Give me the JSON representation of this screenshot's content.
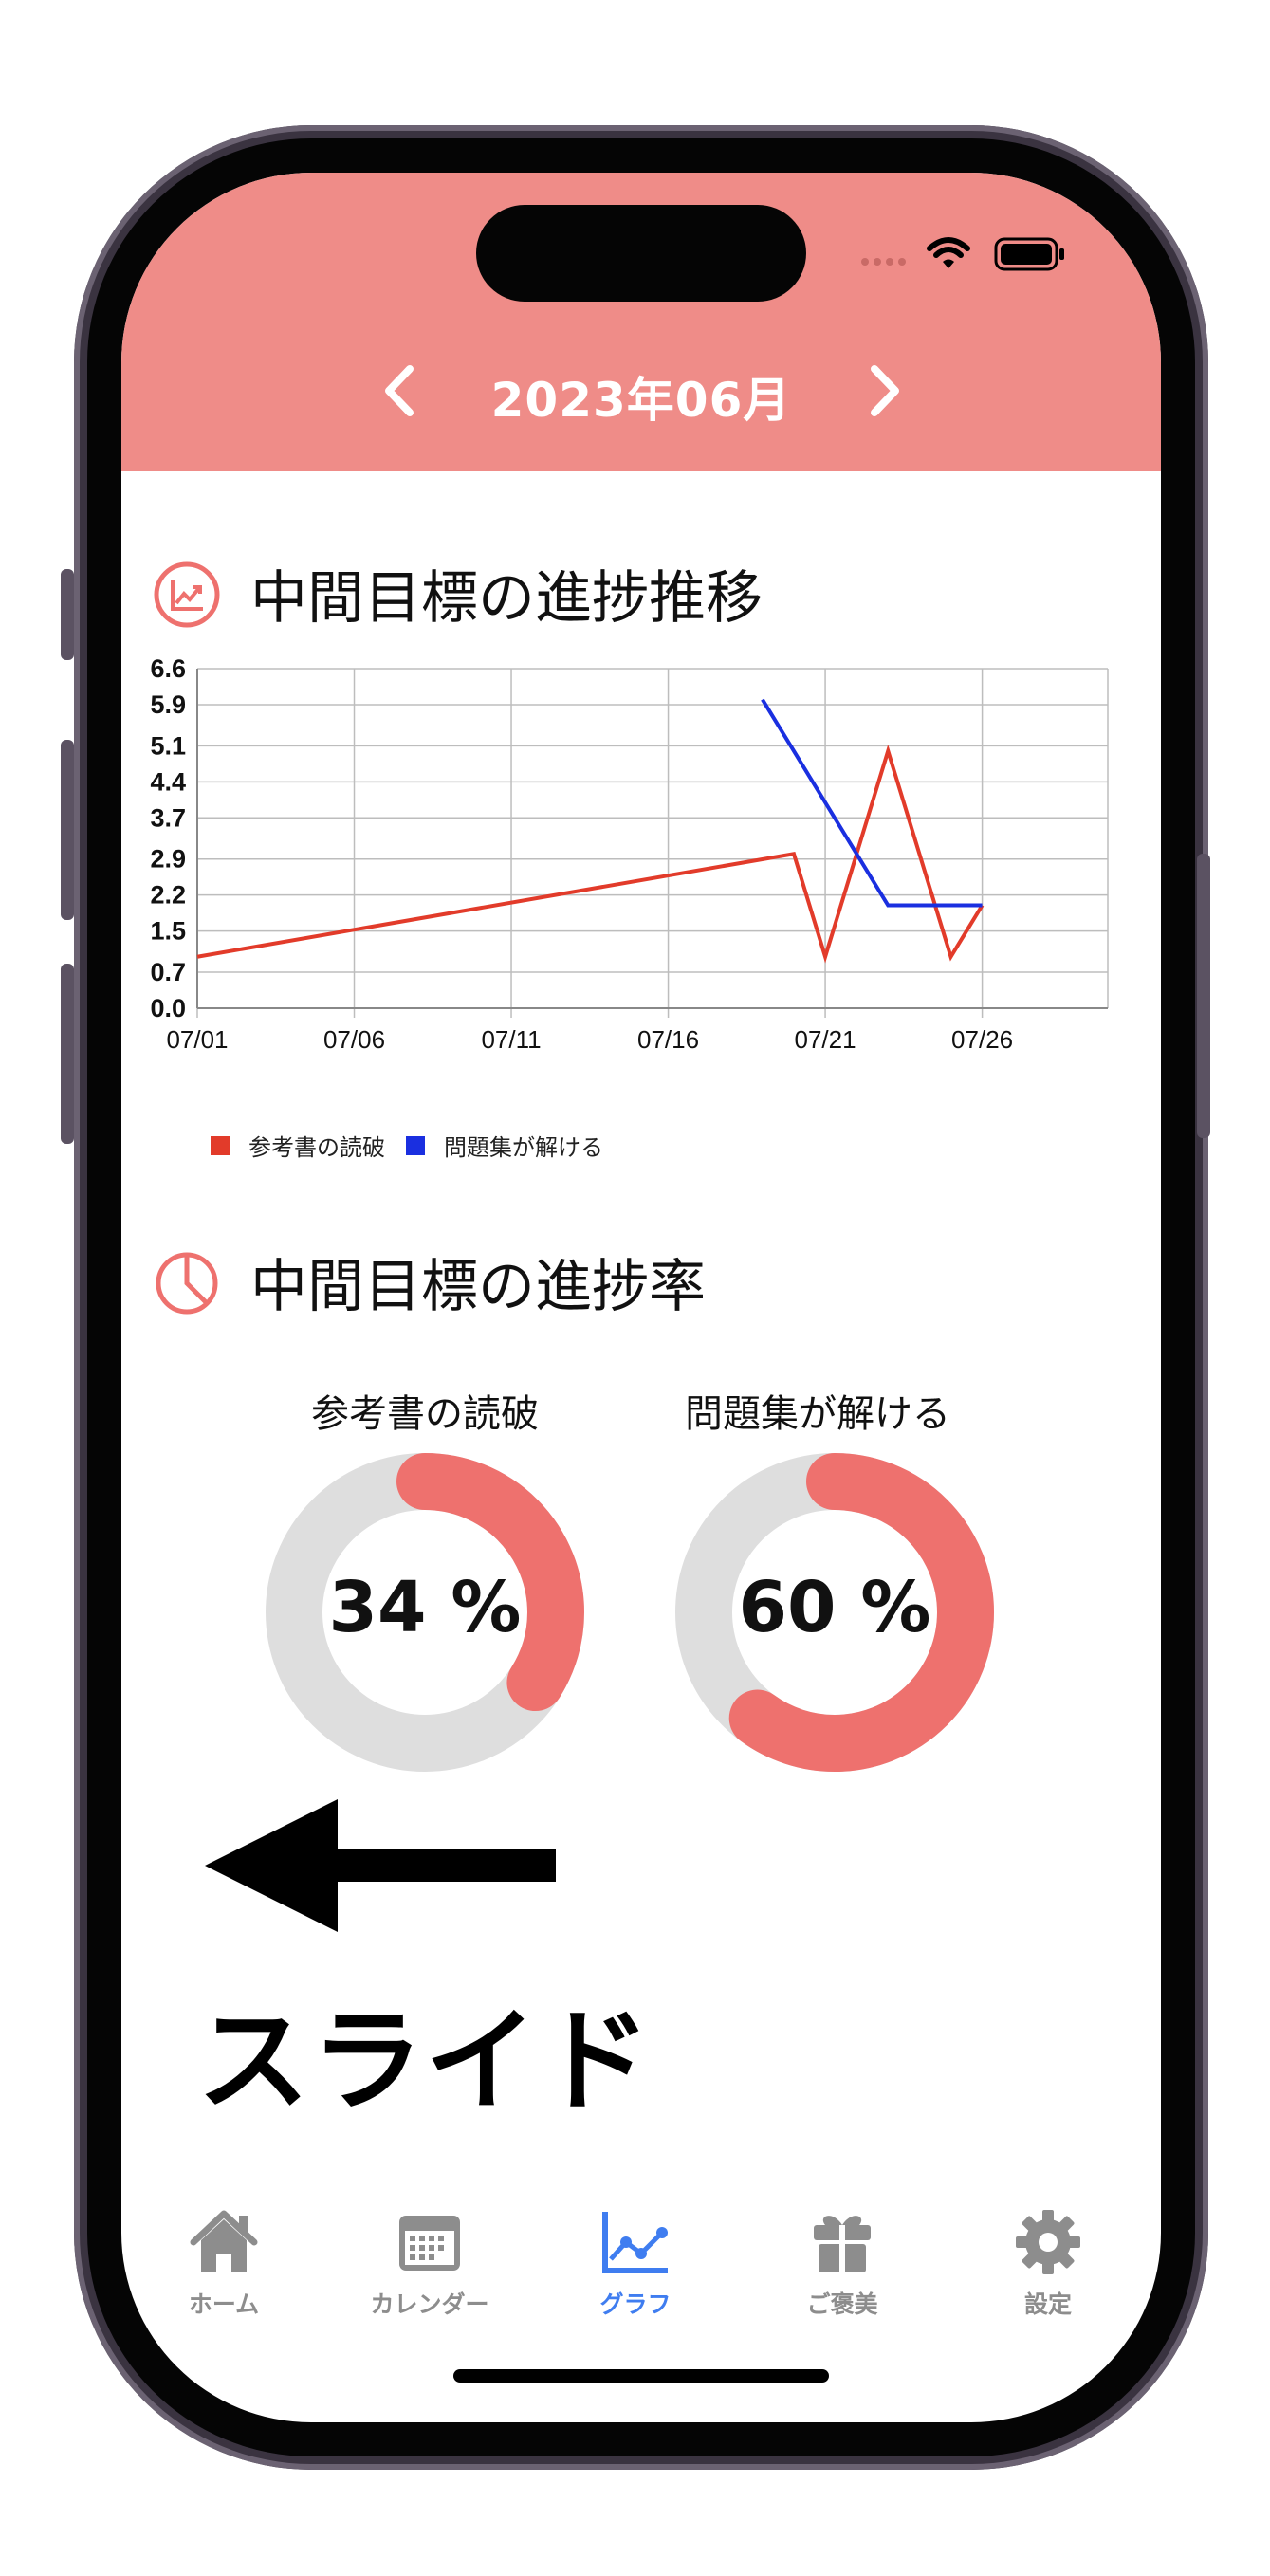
{
  "header": {
    "month_title": "2023年06月",
    "prev_icon": "chevron-left-icon",
    "next_icon": "chevron-right-icon",
    "background": "#ef8c88"
  },
  "status_bar": {
    "icons": [
      "signal-dots-icon",
      "wifi-icon",
      "battery-icon"
    ]
  },
  "progress_trend": {
    "title": "中間目標の進捗推移",
    "icon": "line-chart-icon"
  },
  "chart_data": {
    "type": "line",
    "xlabel": "",
    "ylabel": "",
    "x_ticks": [
      "07/01",
      "07/06",
      "07/11",
      "07/16",
      "07/21",
      "07/26"
    ],
    "y_ticks": [
      "0.0",
      "0.7",
      "1.5",
      "2.2",
      "2.9",
      "3.7",
      "4.4",
      "5.1",
      "5.9",
      "6.6"
    ],
    "ylim": [
      0,
      6.6
    ],
    "xlim": [
      "07/01",
      "07/30"
    ],
    "grid": true,
    "legend_position": "bottom-left",
    "series": [
      {
        "name": "参考書の読破",
        "color": "#e23b2a",
        "points": [
          {
            "x": "07/01",
            "y": 1.0
          },
          {
            "x": "07/20",
            "y": 3.0
          },
          {
            "x": "07/21",
            "y": 1.0
          },
          {
            "x": "07/23",
            "y": 5.0
          },
          {
            "x": "07/25",
            "y": 1.0
          },
          {
            "x": "07/26",
            "y": 2.0
          }
        ]
      },
      {
        "name": "問題集が解ける",
        "color": "#1a2fe0",
        "points": [
          {
            "x": "07/19",
            "y": 6.0
          },
          {
            "x": "07/23",
            "y": 2.0
          },
          {
            "x": "07/26",
            "y": 2.0
          }
        ]
      }
    ]
  },
  "progress_rate": {
    "title": "中間目標の進捗率",
    "icon": "pie-chart-icon",
    "items": [
      {
        "label": "参考書の読破",
        "percent": 34,
        "value_text": "34 %"
      },
      {
        "label": "問題集が解ける",
        "percent": 60,
        "value_text": "60 %"
      }
    ],
    "ring_color": "#ee716e",
    "track_color": "#dedede"
  },
  "hint": {
    "text": "スライド",
    "icon": "left-arrow-icon"
  },
  "tab_bar": {
    "items": [
      {
        "label": "ホーム",
        "icon": "home-icon",
        "active": false
      },
      {
        "label": "カレンダー",
        "icon": "calendar-icon",
        "active": false
      },
      {
        "label": "グラフ",
        "icon": "graph-icon",
        "active": true
      },
      {
        "label": "ご褒美",
        "icon": "gift-icon",
        "active": false
      },
      {
        "label": "設定",
        "icon": "gear-icon",
        "active": false
      }
    ]
  }
}
